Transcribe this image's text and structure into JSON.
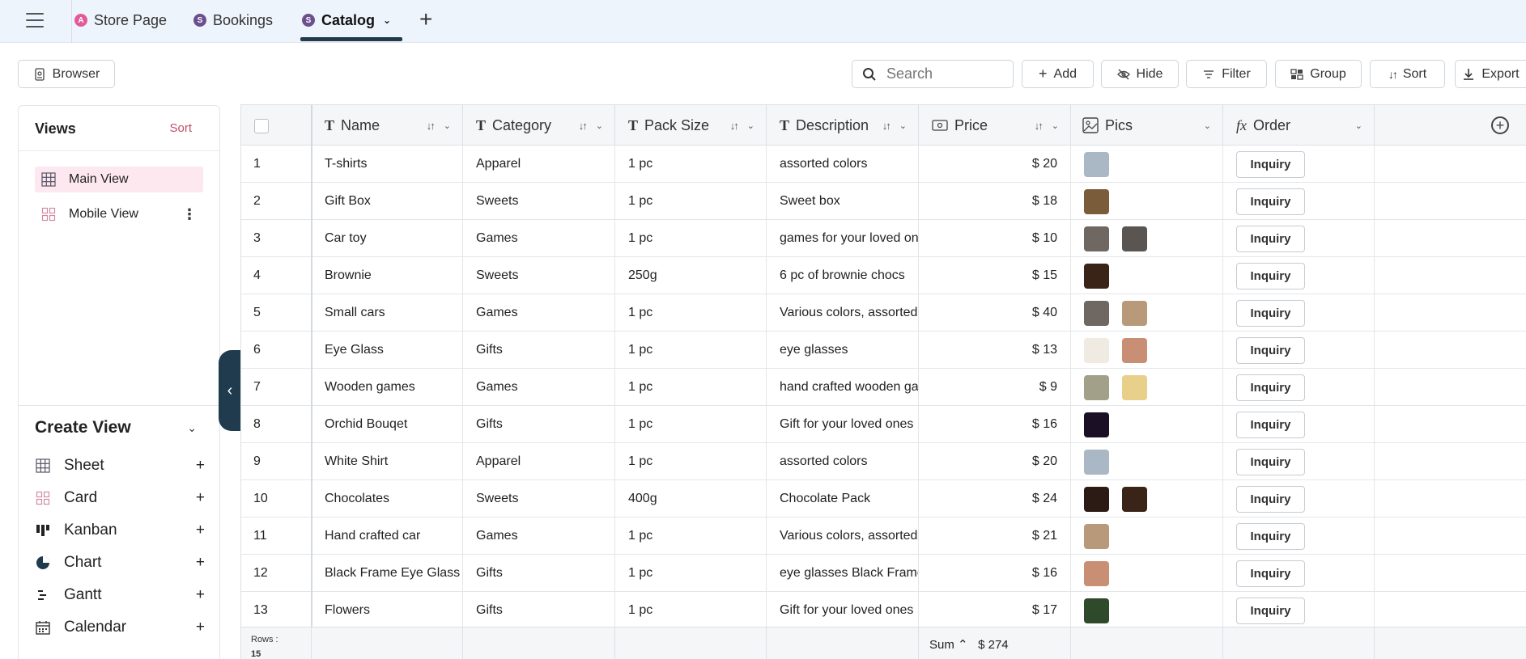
{
  "tabs": [
    {
      "label": "Store Page",
      "badge": "A",
      "color": "#e25a9a"
    },
    {
      "label": "Bookings",
      "badge": "S",
      "color": "#6b4f8f"
    },
    {
      "label": "Catalog",
      "badge": "S",
      "color": "#6b4f8f",
      "active": true
    }
  ],
  "toolbar": {
    "browser": "Browser",
    "search_placeholder": "Search",
    "add": "Add",
    "hide": "Hide",
    "filter": "Filter",
    "group": "Group",
    "sort": "Sort",
    "export": "Export"
  },
  "views": {
    "title": "Views",
    "sort": "Sort",
    "items": [
      {
        "label": "Main View",
        "icon": "grid-icon",
        "active": true
      },
      {
        "label": "Mobile View",
        "icon": "card-grid-icon"
      }
    ]
  },
  "create_view": {
    "title": "Create View",
    "items": [
      {
        "label": "Sheet",
        "icon": "grid-icon"
      },
      {
        "label": "Card",
        "icon": "card-grid-icon"
      },
      {
        "label": "Kanban",
        "icon": "kanban-icon"
      },
      {
        "label": "Chart",
        "icon": "pie-chart-icon"
      },
      {
        "label": "Gantt",
        "icon": "gantt-icon"
      },
      {
        "label": "Calendar",
        "icon": "calendar-icon"
      }
    ]
  },
  "columns": [
    {
      "label": "Name",
      "type": "T"
    },
    {
      "label": "Category",
      "type": "T"
    },
    {
      "label": "Pack Size",
      "type": "T"
    },
    {
      "label": "Description",
      "type": "T"
    },
    {
      "label": "Price",
      "type": "money"
    },
    {
      "label": "Pics",
      "type": "image"
    },
    {
      "label": "Order",
      "type": "fx"
    }
  ],
  "rows": [
    {
      "n": "1",
      "name": "T-shirts",
      "category": "Apparel",
      "pack": "1 pc",
      "desc": "assorted colors",
      "price": "$ 20",
      "pics": [
        "#a9b8c4"
      ],
      "order": "Inquiry"
    },
    {
      "n": "2",
      "name": "Gift Box",
      "category": "Sweets",
      "pack": "1 pc",
      "desc": "Sweet box",
      "price": "$ 18",
      "pics": [
        "#7a5c3a"
      ],
      "order": "Inquiry"
    },
    {
      "n": "3",
      "name": "Car toy",
      "category": "Games",
      "pack": "1 pc",
      "desc": "games for your loved ones",
      "price": "$ 10",
      "pics": [
        "#6f6862",
        "#5a5550"
      ],
      "order": "Inquiry"
    },
    {
      "n": "4",
      "name": "Brownie",
      "category": "Sweets",
      "pack": "250g",
      "desc": "6 pc of brownie chocs",
      "price": "$ 15",
      "pics": [
        "#3a2418"
      ],
      "order": "Inquiry"
    },
    {
      "n": "5",
      "name": "Small cars",
      "category": "Games",
      "pack": "1 pc",
      "desc": "Various colors, assorted",
      "price": "$ 40",
      "pics": [
        "#6f6862",
        "#b89a7a"
      ],
      "order": "Inquiry"
    },
    {
      "n": "6",
      "name": "Eye Glass",
      "category": "Gifts",
      "pack": "1 pc",
      "desc": "eye glasses",
      "price": "$ 13",
      "pics": [
        "#efeae2",
        "#c98f74"
      ],
      "order": "Inquiry"
    },
    {
      "n": "7",
      "name": "Wooden games",
      "category": "Games",
      "pack": "1 pc",
      "desc": "hand crafted wooden games",
      "price": "$ 9",
      "pics": [
        "#a3a08a",
        "#e8cf8a"
      ],
      "order": "Inquiry"
    },
    {
      "n": "8",
      "name": "Orchid Bouqet",
      "category": "Gifts",
      "pack": "1 pc",
      "desc": "Gift for your loved ones",
      "price": "$ 16",
      "pics": [
        "#1a0f24"
      ],
      "order": "Inquiry"
    },
    {
      "n": "9",
      "name": "White Shirt",
      "category": "Apparel",
      "pack": "1 pc",
      "desc": "assorted colors",
      "price": "$ 20",
      "pics": [
        "#a9b8c4"
      ],
      "order": "Inquiry"
    },
    {
      "n": "10",
      "name": "Chocolates",
      "category": "Sweets",
      "pack": "400g",
      "desc": "Chocolate Pack",
      "price": "$ 24",
      "pics": [
        "#2c1a14",
        "#3a2418"
      ],
      "order": "Inquiry"
    },
    {
      "n": "11",
      "name": "Hand crafted car",
      "category": "Games",
      "pack": "1 pc",
      "desc": "Various colors, assorted",
      "price": "$ 21",
      "pics": [
        "#b89a7a"
      ],
      "order": "Inquiry"
    },
    {
      "n": "12",
      "name": "Black Frame Eye Glass",
      "category": "Gifts",
      "pack": "1 pc",
      "desc": "eye glasses Black Frame",
      "price": "$ 16",
      "pics": [
        "#c98f74"
      ],
      "order": "Inquiry"
    },
    {
      "n": "13",
      "name": "Flowers",
      "category": "Gifts",
      "pack": "1 pc",
      "desc": "Gift for your loved ones",
      "price": "$ 17",
      "pics": [
        "#2f4a2a"
      ],
      "order": "Inquiry"
    }
  ],
  "footer": {
    "rows_label": "Rows :",
    "rows_count": "15",
    "sum_label": "Sum",
    "sum_value": "$ 274"
  }
}
